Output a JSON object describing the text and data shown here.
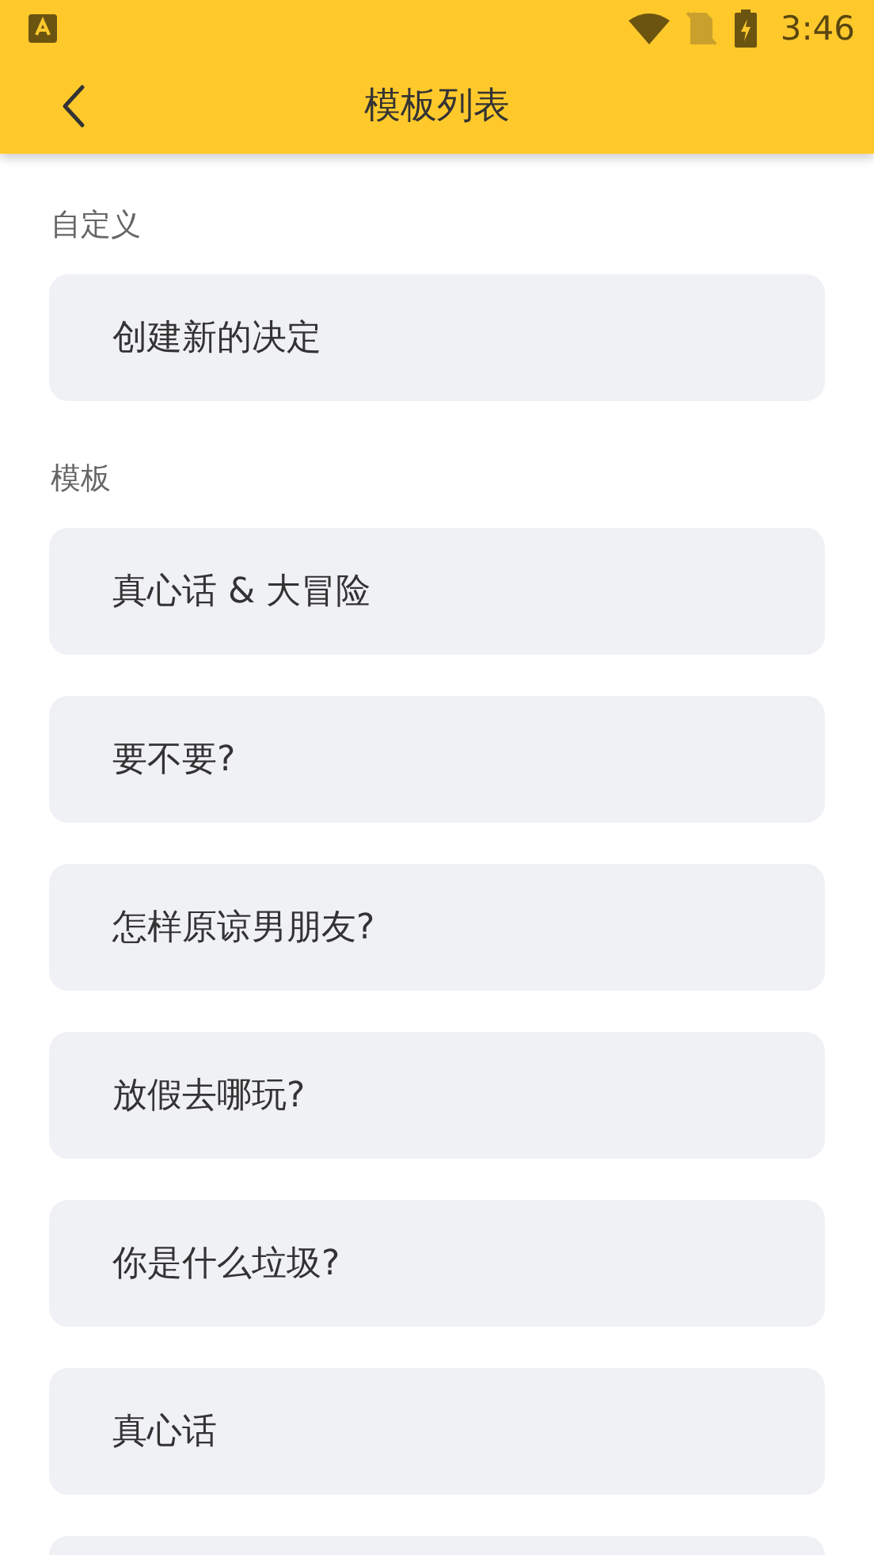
{
  "status_bar": {
    "time": "3:46"
  },
  "app_bar": {
    "title": "模板列表"
  },
  "sections": [
    {
      "title": "自定义",
      "items": [
        {
          "label": "创建新的决定"
        }
      ]
    },
    {
      "title": "模板",
      "items": [
        {
          "label": "真心话 & 大冒险"
        },
        {
          "label": "要不要?"
        },
        {
          "label": "怎样原谅男朋友?"
        },
        {
          "label": "放假去哪玩?"
        },
        {
          "label": "你是什么垃圾?"
        },
        {
          "label": "真心话"
        }
      ]
    }
  ]
}
